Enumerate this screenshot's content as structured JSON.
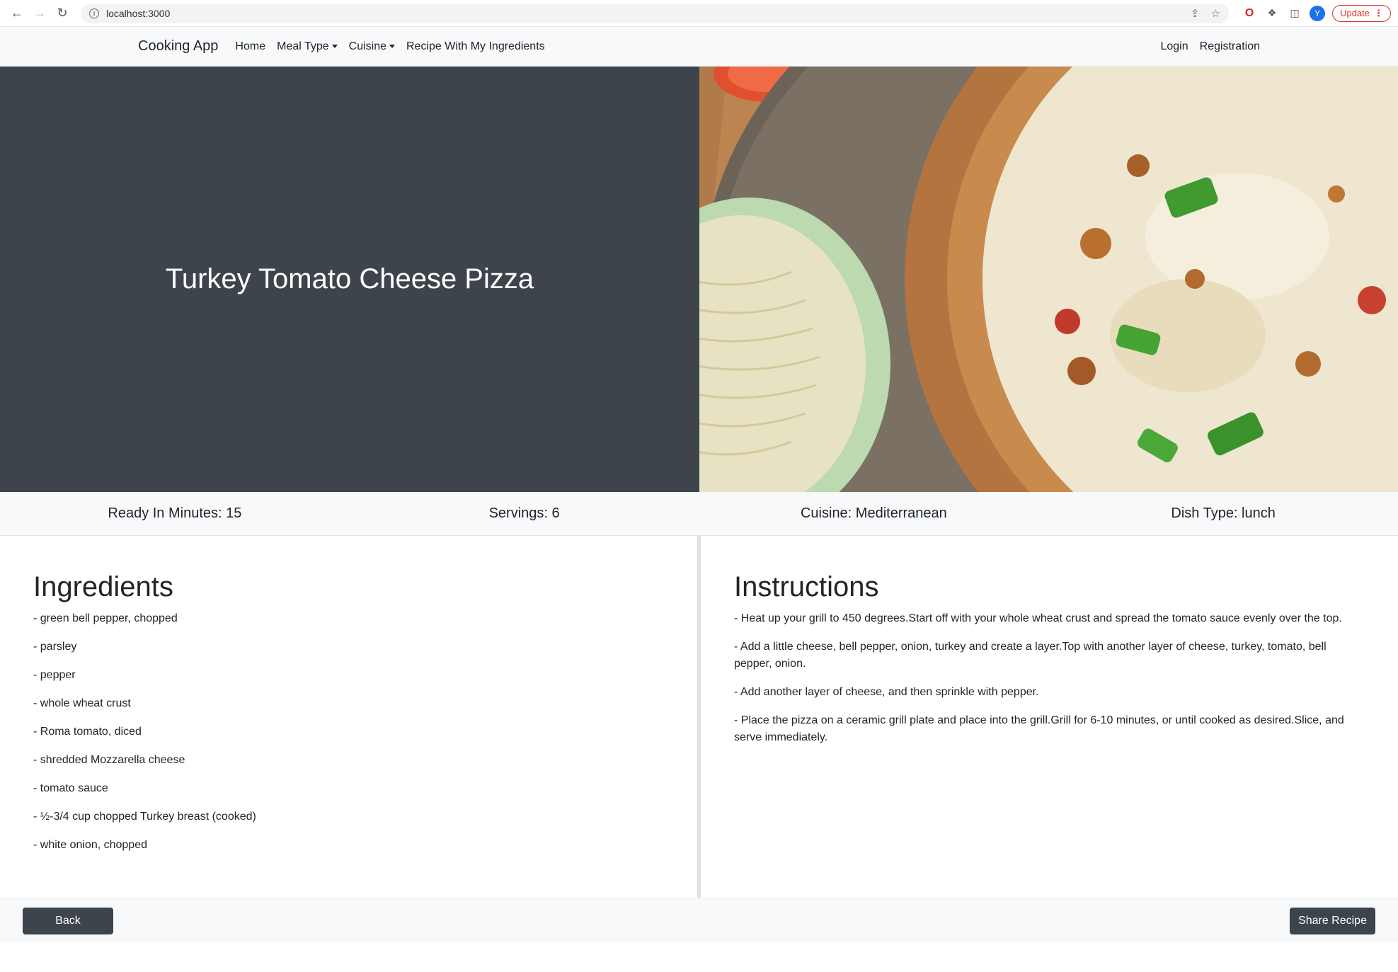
{
  "browser": {
    "url": "localhost:3000",
    "profile_initial": "Y",
    "update_label": "Update"
  },
  "navbar": {
    "brand": "Cooking App",
    "links": [
      "Home",
      "Meal Type",
      "Cuisine",
      "Recipe With My Ingredients"
    ],
    "right_links": [
      "Login",
      "Registration"
    ]
  },
  "recipe": {
    "title": "Turkey Tomato Cheese Pizza",
    "ready_in": "Ready In Minutes: 15",
    "servings": "Servings: 6",
    "cuisine": "Cuisine: Mediterranean",
    "dish_type": "Dish Type: lunch"
  },
  "ingredients": {
    "heading": "Ingredients",
    "items": [
      "- green bell pepper, chopped",
      "- parsley",
      "- pepper",
      "- whole wheat crust",
      "- Roma tomato, diced",
      "- shredded Mozzarella cheese",
      "- tomato sauce",
      "- ½-3/4 cup chopped Turkey breast (cooked)",
      "- white onion, chopped"
    ]
  },
  "instructions": {
    "heading": "Instructions",
    "items": [
      "- Heat up your grill to 450 degrees.Start off with your whole wheat crust and spread the tomato sauce evenly over the top.",
      "- Add a little cheese, bell pepper, onion, turkey and create a layer.Top with another layer of cheese, turkey, tomato, bell pepper, onion.",
      "- Add another layer of cheese, and then sprinkle with pepper.",
      "- Place the pizza on a ceramic grill plate and place into the grill.Grill for 6-10 minutes, or until cooked as desired.Slice, and serve immediately."
    ]
  },
  "footer": {
    "back_label": "Back",
    "share_label": "Share Recipe"
  }
}
